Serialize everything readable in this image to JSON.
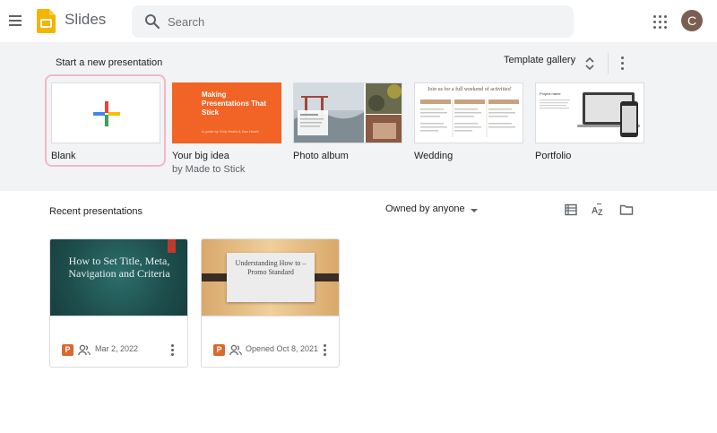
{
  "app": {
    "title": "Slides",
    "avatar_letter": "C"
  },
  "search": {
    "placeholder": "Search"
  },
  "templates_section": {
    "title": "Start a new presentation",
    "gallery_label": "Template gallery",
    "items": [
      {
        "name": "Blank",
        "sub": ""
      },
      {
        "name": "Your big idea",
        "sub": "by Made to Stick",
        "thumb_title": "Making Presentations That Stick",
        "thumb_sub": "A guide by Chip Heath & Dan Heath"
      },
      {
        "name": "Photo album",
        "sub": ""
      },
      {
        "name": "Wedding",
        "sub": "",
        "thumb_title": "Join us for a full weekend of activities!"
      },
      {
        "name": "Portfolio",
        "sub": "",
        "thumb_title": "Project name"
      }
    ]
  },
  "recent": {
    "title": "Recent presentations",
    "owner_filter": "Owned by anyone",
    "docs": [
      {
        "thumb_title": "How to Set Title, Meta, Navigation and Criteria",
        "meta": "Mar 2, 2022",
        "type_badge": "P"
      },
      {
        "thumb_title": "Understanding How to – Promo Standard",
        "meta": "Opened Oct 8, 2021",
        "type_badge": "P"
      }
    ]
  },
  "icons": {
    "menu": "hamburger-menu-icon",
    "search": "search-icon",
    "apps": "google-apps-icon",
    "sort": "sort-az-icon",
    "list": "list-view-icon",
    "folder": "folder-icon",
    "more": "more-vert-icon"
  },
  "colors": {
    "accent_orange": "#f26426",
    "slides_yellow": "#f4b400",
    "focus_ring": "#f4b6c7",
    "band_bg": "#f1f3f4"
  }
}
